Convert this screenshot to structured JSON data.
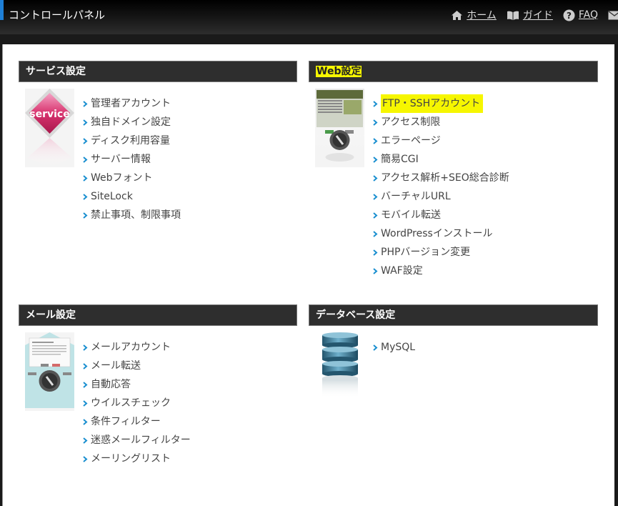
{
  "header": {
    "title": "コントロールパネル",
    "nav": [
      {
        "label": "ホーム",
        "icon": "home-icon"
      },
      {
        "label": "ガイド",
        "icon": "book-icon"
      },
      {
        "label": "FAQ",
        "icon": "question-icon"
      }
    ],
    "extra_icon": "mail-icon"
  },
  "sections": {
    "service": {
      "title": "サービス設定",
      "badge": "service",
      "items": [
        "管理者アカウント",
        "独自ドメイン設定",
        "ディスク利用容量",
        "サーバー情報",
        "Webフォント",
        "SiteLock",
        "禁止事項、制限事項"
      ]
    },
    "web": {
      "title": "Web設定",
      "items": [
        "FTP・SSHアカウント",
        "アクセス制限",
        "エラーページ",
        "簡易CGI",
        "アクセス解析+SEO総合診断",
        "バーチャルURL",
        "モバイル転送",
        "WordPressインストール",
        "PHPバージョン変更",
        "WAF設定"
      ]
    },
    "mail": {
      "title": "メール設定",
      "items": [
        "メールアカウント",
        "メール転送",
        "自動応答",
        "ウイルスチェック",
        "条件フィルター",
        "迷惑メールフィルター",
        "メーリングリスト"
      ]
    },
    "database": {
      "title": "データベース設定",
      "items": [
        "MySQL"
      ]
    }
  },
  "colors": {
    "highlight": "#f6f600",
    "accent": "#1e7fd6",
    "arrow": "#1a8fd0",
    "header_bg": "#2e2e2e"
  }
}
